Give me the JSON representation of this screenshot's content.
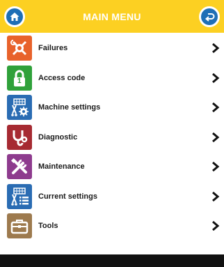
{
  "header": {
    "title": "MAIN MENU"
  },
  "colors": {
    "header": "#fcd022",
    "button_blue": "#1f6fb6",
    "failures": "#e8622b",
    "access_code": "#2fa13a",
    "machine_settings": "#2a6cb3",
    "diagnostic": "#a62a32",
    "maintenance": "#8e3b8e",
    "current_settings": "#2a6cb3",
    "tools": "#9d7a4e"
  },
  "menu": {
    "items": [
      {
        "label": "Failures",
        "icon": "wrench-warning-icon"
      },
      {
        "label": "Access code",
        "icon": "padlock-icon",
        "badge": "1"
      },
      {
        "label": "Machine settings",
        "icon": "machine-gear-icon"
      },
      {
        "label": "Diagnostic",
        "icon": "stethoscope-icon"
      },
      {
        "label": "Maintenance",
        "icon": "tools-crossed-icon"
      },
      {
        "label": "Current settings",
        "icon": "machine-list-icon"
      },
      {
        "label": "Tools",
        "icon": "toolbox-icon"
      }
    ]
  }
}
